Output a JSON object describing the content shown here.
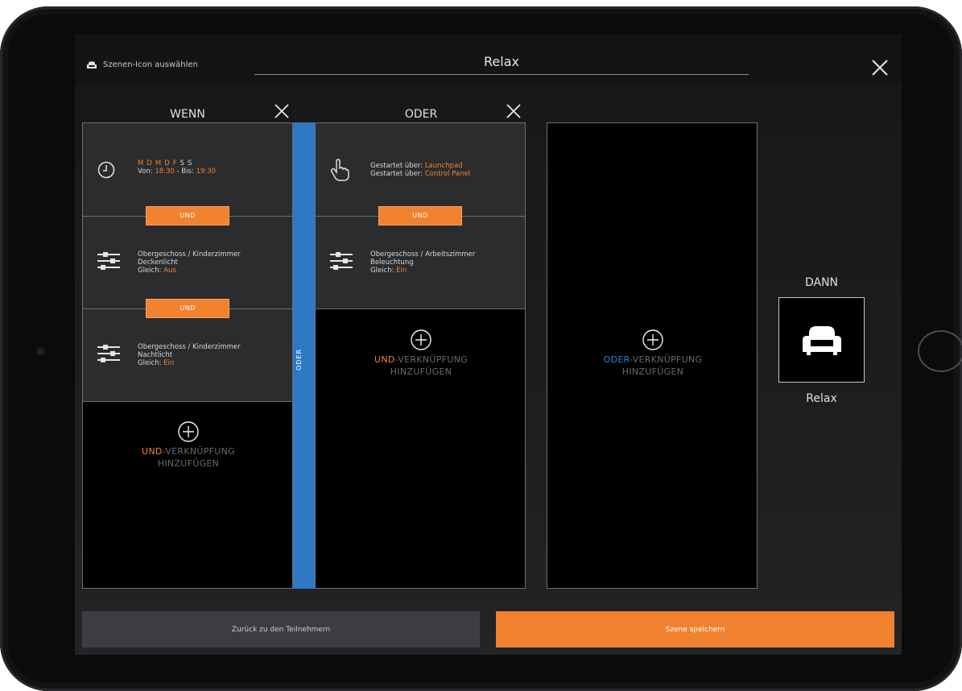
{
  "header": {
    "icon_label": "Szenen-Icon auswählen",
    "icon_name": "armchair-icon",
    "title": "Relax"
  },
  "wenn": {
    "heading": "WENN",
    "cells": [
      {
        "icon": "clock-icon",
        "days": [
          "M",
          "D",
          "M",
          "D",
          "F",
          "S",
          "S"
        ],
        "from_label": "Von:",
        "from": "18:30",
        "sep": "-",
        "to_label": "Bis:",
        "to": "19:30"
      },
      {
        "icon": "sliders-icon",
        "line1": "Obergeschoss / Kinderzimmer",
        "line2": "Deckenlicht",
        "cond_label": "Gleich:",
        "cond_value": "Aus"
      },
      {
        "icon": "sliders-icon",
        "line1": "Obergeschoss / Kinderzimmer",
        "line2": "Nachtlicht",
        "cond_label": "Gleich:",
        "cond_value": "Ein"
      }
    ],
    "und_labels": [
      "UND",
      "UND"
    ],
    "add": {
      "prefix": "UND",
      "rest": "-VERKNÜPFUNG",
      "line2": "HINZUFÜGEN"
    }
  },
  "oder_bar": "ODER",
  "oder": {
    "heading": "ODER",
    "cells": [
      {
        "icon": "hand-pointer-icon",
        "l1_label": "Gestartet über:",
        "l1_value": "Launchpad",
        "l2_label": "Gestartet über:",
        "l2_value": "Control Panel"
      },
      {
        "icon": "sliders-icon",
        "line1": "Obergeschoss / Arbeitszimmer",
        "line2": "Beleuchtung",
        "cond_label": "Gleich:",
        "cond_value": "Ein"
      }
    ],
    "und_labels": [
      "UND"
    ],
    "add": {
      "prefix": "UND",
      "rest": "-VERKNÜPFUNG",
      "line2": "HINZUFÜGEN"
    }
  },
  "third_column": {
    "add": {
      "prefix": "ODER",
      "rest": "-VERKNÜPFUNG",
      "line2": "HINZUFÜGEN"
    }
  },
  "dann": {
    "heading": "DANN",
    "scene_icon": "armchair-icon",
    "scene_label": "Relax"
  },
  "footer": {
    "back_label": "Zurück zu den Teilnehmern",
    "save_label": "Szene speichern"
  },
  "colors": {
    "accent": "#f08230",
    "blue": "#2f78c4"
  }
}
